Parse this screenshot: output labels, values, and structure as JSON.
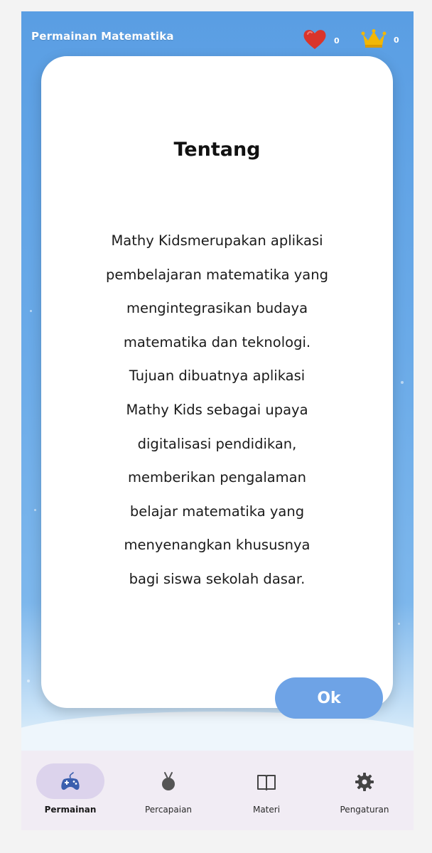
{
  "header": {
    "title": "Permainan Matematika",
    "hearts_count": "0",
    "crowns_count": "0"
  },
  "dialog": {
    "title": "Tentang",
    "body_lines": [
      "Mathy Kidsmerupakan aplikasi",
      "pembelajaran matematika yang",
      "mengintegrasikan budaya",
      "matematika dan teknologi.",
      "Tujuan dibuatnya aplikasi",
      "Mathy Kids sebagai upaya",
      "digitalisasi pendidikan,",
      "memberikan pengalaman",
      "belajar matematika yang",
      "menyenangkan khususnya",
      "bagi siswa sekolah dasar."
    ],
    "ok_label": "Ok"
  },
  "bottom_nav": {
    "items": [
      {
        "label": "Permainan",
        "icon": "gamepad-icon",
        "active": true
      },
      {
        "label": "Percapaian",
        "icon": "medal-icon",
        "active": false
      },
      {
        "label": "Materi",
        "icon": "book-icon",
        "active": false
      },
      {
        "label": "Pengaturan",
        "icon": "gear-icon",
        "active": false
      }
    ]
  },
  "colors": {
    "accent": "#6ea3e6",
    "heart": "#d9342b",
    "crown": "#f2b705",
    "nav_background": "#f1ecf4",
    "nav_active_pill": "#dcd3ec"
  }
}
